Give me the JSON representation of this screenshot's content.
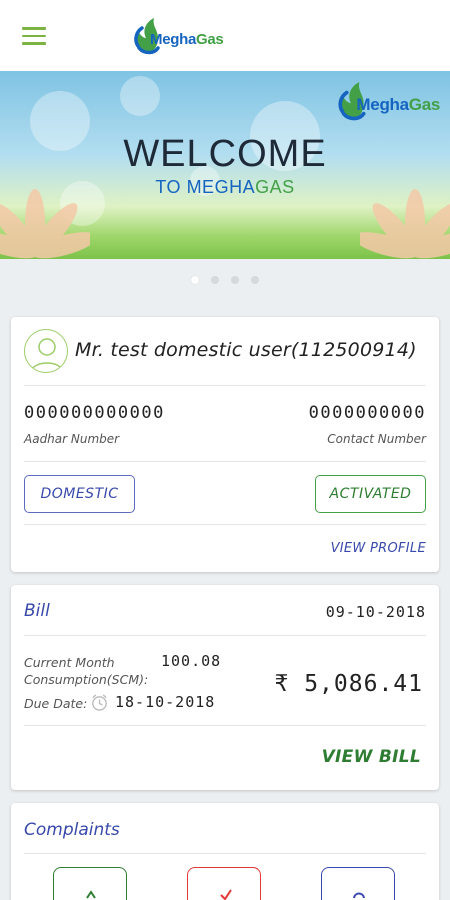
{
  "app": {
    "logo_megha": "Megha",
    "logo_gas": "Gas"
  },
  "banner": {
    "welcome": "WELCOME",
    "sub_to": "TO MEGHA",
    "sub_gas": "GAS",
    "slides": 4,
    "active_slide": 1
  },
  "profile": {
    "name": "Mr. test domestic user(112500914)",
    "aadhar_value": "000000000000",
    "aadhar_label": "Aadhar Number",
    "contact_value": "0000000000",
    "contact_label": "Contact Number",
    "type_badge": "DOMESTIC",
    "status_badge": "ACTIVATED",
    "view_profile": "VIEW PROFILE"
  },
  "bill": {
    "title": "Bill",
    "date": "09-10-2018",
    "consumption_label_1": "Current Month",
    "consumption_label_2": "Consumption(SCM):",
    "consumption_value": "100.08",
    "due_label": "Due Date:",
    "due_value": "18-10-2018",
    "amount": "₹ 5,086.41",
    "view_bill": "VIEW BILL"
  },
  "complaints": {
    "title": "Complaints"
  },
  "colors": {
    "accent_green": "#7cb342",
    "brand_blue": "#1565c0",
    "brand_green": "#43a047",
    "label_indigo": "#3949ab"
  }
}
